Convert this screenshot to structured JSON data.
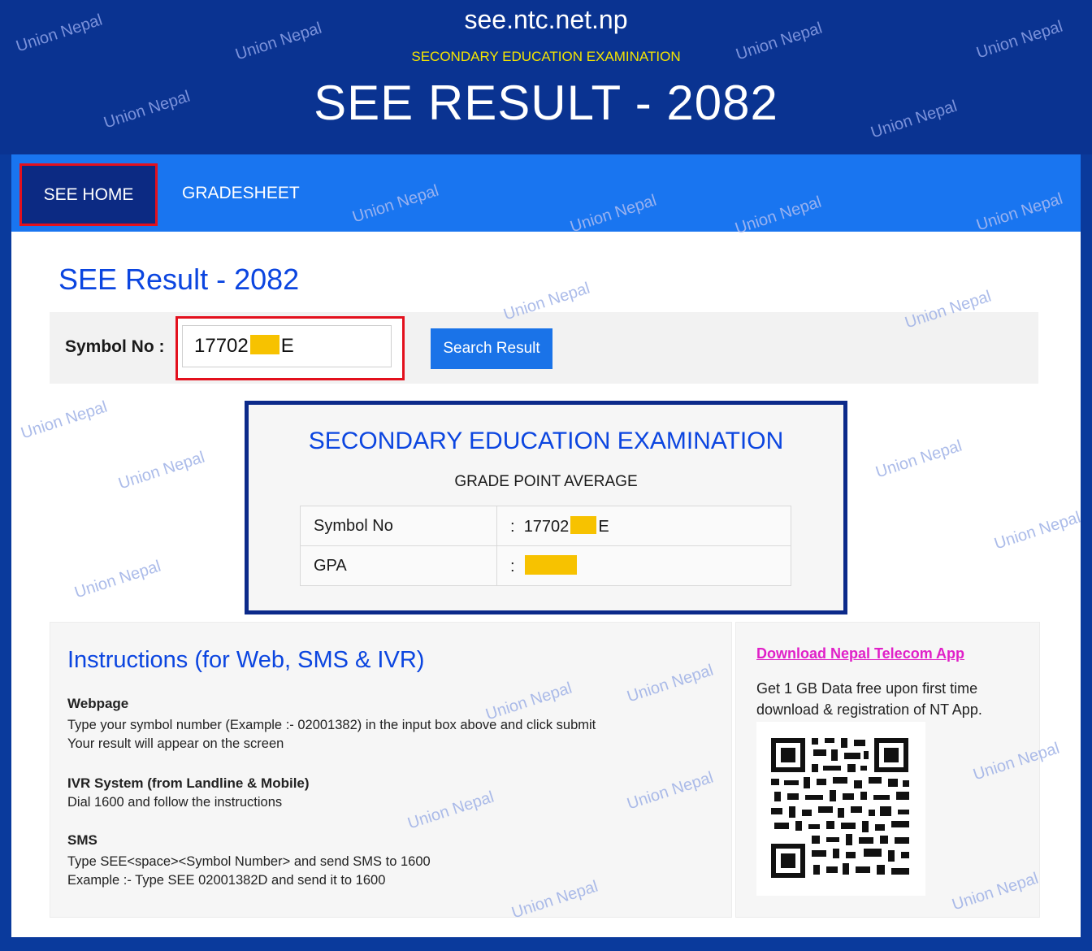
{
  "header": {
    "domain": "see.ntc.net.np",
    "subtitle": "SECONDARY EDUCATION EXAMINATION",
    "title": "SEE RESULT - 2082"
  },
  "nav": {
    "home": "SEE HOME",
    "gradesheet": "GRADESHEET"
  },
  "main": {
    "title": "SEE Result - 2082",
    "search": {
      "label": "Symbol No :",
      "value_prefix": "17702",
      "value_suffix": "E",
      "button": "Search Result"
    },
    "result": {
      "heading": "SECONDARY EDUCATION EXAMINATION",
      "subheading": "GRADE POINT AVERAGE",
      "rows": [
        {
          "key": "Symbol No",
          "sep": ":",
          "value_prefix": "17702",
          "value_suffix": "E"
        },
        {
          "key": "GPA",
          "sep": ":"
        }
      ]
    },
    "instructions": {
      "title": "Instructions (for Web, SMS & IVR)",
      "webpage": {
        "heading": "Webpage",
        "line1": "Type your symbol number (Example :- 02001382) in the input box above and click submit",
        "line2": "Your result will appear on the screen"
      },
      "ivr": {
        "heading": "IVR System (from Landline & Mobile)",
        "line1": "Dial 1600 and follow the instructions"
      },
      "sms": {
        "heading": "SMS",
        "line1": "Type SEE<space><Symbol Number> and send SMS to 1600",
        "line2": "Example :- Type SEE  02001382D and send it to 1600"
      }
    },
    "app": {
      "link": "Download Nepal Telecom App",
      "description": "Get 1 GB Data free upon first time download & registration of NT App."
    }
  },
  "watermark": "Union Nepal",
  "colors": {
    "header_bg": "#0a3391",
    "nav_bg": "#1975f0",
    "accent_blue": "#0b45e0",
    "highlight_red": "#e3101d",
    "redaction_yellow": "#f7c200",
    "link_magenta": "#e020c8"
  }
}
